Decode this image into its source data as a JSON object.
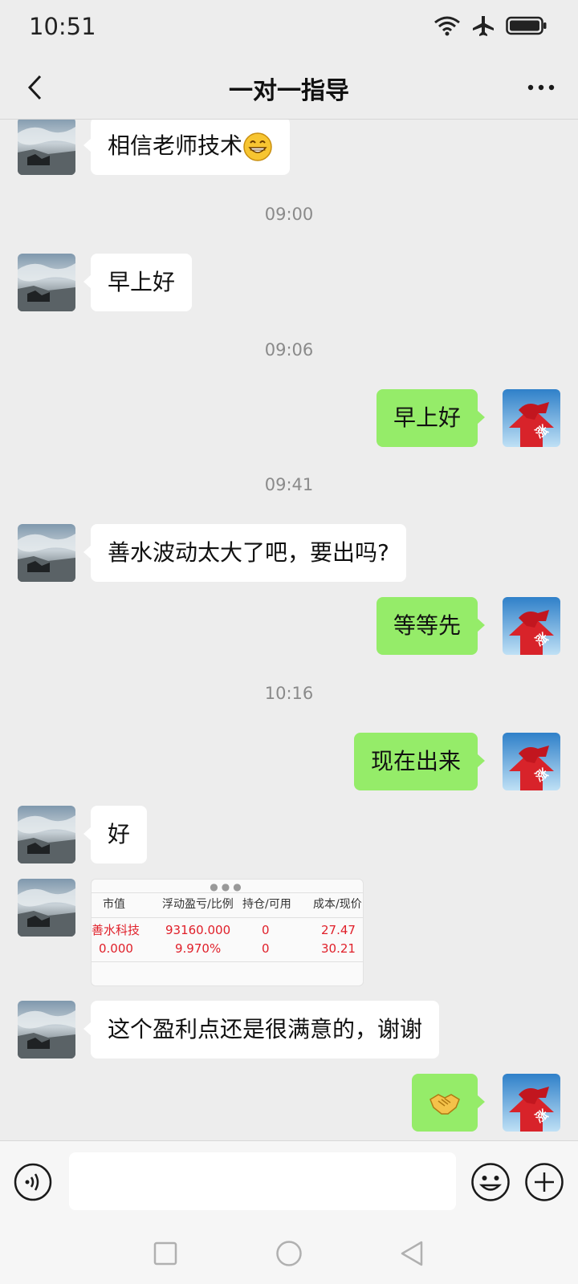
{
  "status_bar": {
    "time": "10:51"
  },
  "header": {
    "title": "一对一指导"
  },
  "messages": [
    {
      "side": "left",
      "text": "相信老师技术",
      "emoji": "grin-emoji"
    },
    {
      "type": "time",
      "text": "09:00"
    },
    {
      "side": "left",
      "text": "早上好"
    },
    {
      "type": "time",
      "text": "09:06"
    },
    {
      "side": "right",
      "text": "早上好"
    },
    {
      "type": "time",
      "text": "09:41"
    },
    {
      "side": "left",
      "text": "善水波动太大了吧，要出吗?"
    },
    {
      "side": "right",
      "text": "等等先"
    },
    {
      "type": "time",
      "text": "10:16"
    },
    {
      "side": "right",
      "text": "现在出来"
    },
    {
      "side": "left",
      "text": "好"
    },
    {
      "side": "left",
      "type": "image"
    },
    {
      "side": "left",
      "text": "这个盈利点还是很满意的，谢谢"
    },
    {
      "side": "right",
      "emoji": "handshake-emoji"
    }
  ],
  "screenshot_table": {
    "headers": [
      "市值",
      "浮动盈亏/比例",
      "持仓/可用",
      "成本/现价"
    ],
    "row1": [
      "善水科技",
      "93160.000",
      "0",
      "27.47"
    ],
    "row2": [
      "0.000",
      "9.970%",
      "0",
      "30.21"
    ]
  },
  "avatars": {
    "right_badge": "涨"
  },
  "input": {
    "placeholder": ""
  },
  "colors": {
    "chat_bg": "#ededed",
    "self_bubble": "#95ec69",
    "other_bubble": "#ffffff",
    "gain_red": "#e0202a"
  }
}
